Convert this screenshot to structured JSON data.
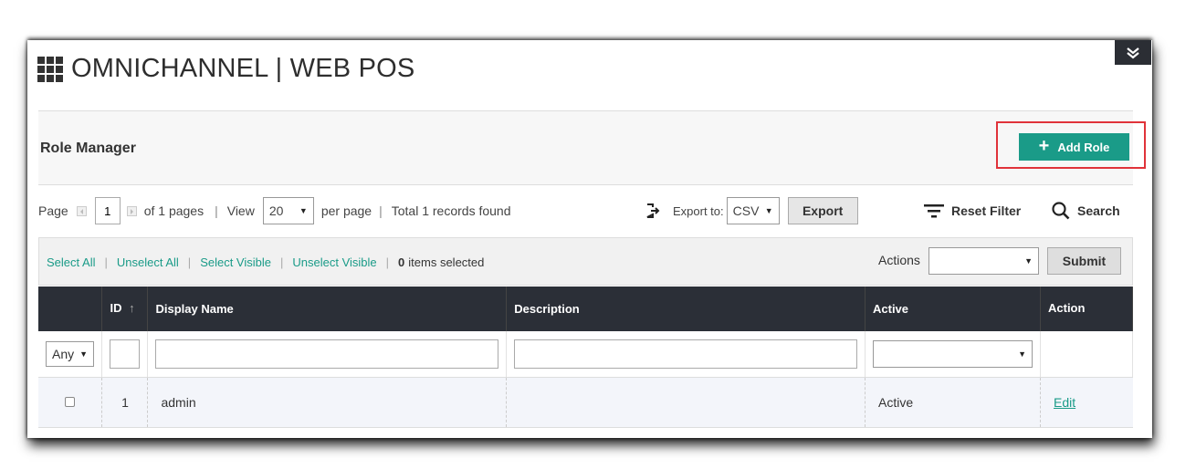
{
  "app": {
    "title": "OMNICHANNEL | WEB POS"
  },
  "header": {
    "heading": "Role Manager",
    "add_role_label": "Add Role"
  },
  "toolbar": {
    "page_label": "Page",
    "page_value": "1",
    "of_pages": "of 1 pages",
    "sep": "|",
    "view_label": "View",
    "per_page_value": "20",
    "per_page_label": "per page",
    "total_records": "Total 1 records found",
    "export_to_label": "Export to:",
    "export_format": "CSV",
    "export_button": "Export",
    "reset_filter": "Reset Filter",
    "search": "Search"
  },
  "massaction": {
    "select_all": "Select All",
    "unselect_all": "Unselect All",
    "select_visible": "Select Visible",
    "unselect_visible": "Unselect Visible",
    "sep": "|",
    "selected_count": "0",
    "selected_suffix": "items selected",
    "actions_label": "Actions",
    "actions_value": "",
    "submit_label": "Submit"
  },
  "grid": {
    "columns": {
      "id": "ID",
      "display_name": "Display Name",
      "description": "Description",
      "active": "Active",
      "action": "Action"
    },
    "sort_indicator": "↑",
    "filters": {
      "select_value": "Any",
      "active_value": ""
    },
    "rows": [
      {
        "id": "1",
        "display_name": "admin",
        "description": "",
        "active": "Active",
        "action": "Edit"
      }
    ]
  },
  "colors": {
    "accent": "#1a9b88",
    "header_dark": "#2b2f37",
    "highlight": "#e0333a"
  }
}
